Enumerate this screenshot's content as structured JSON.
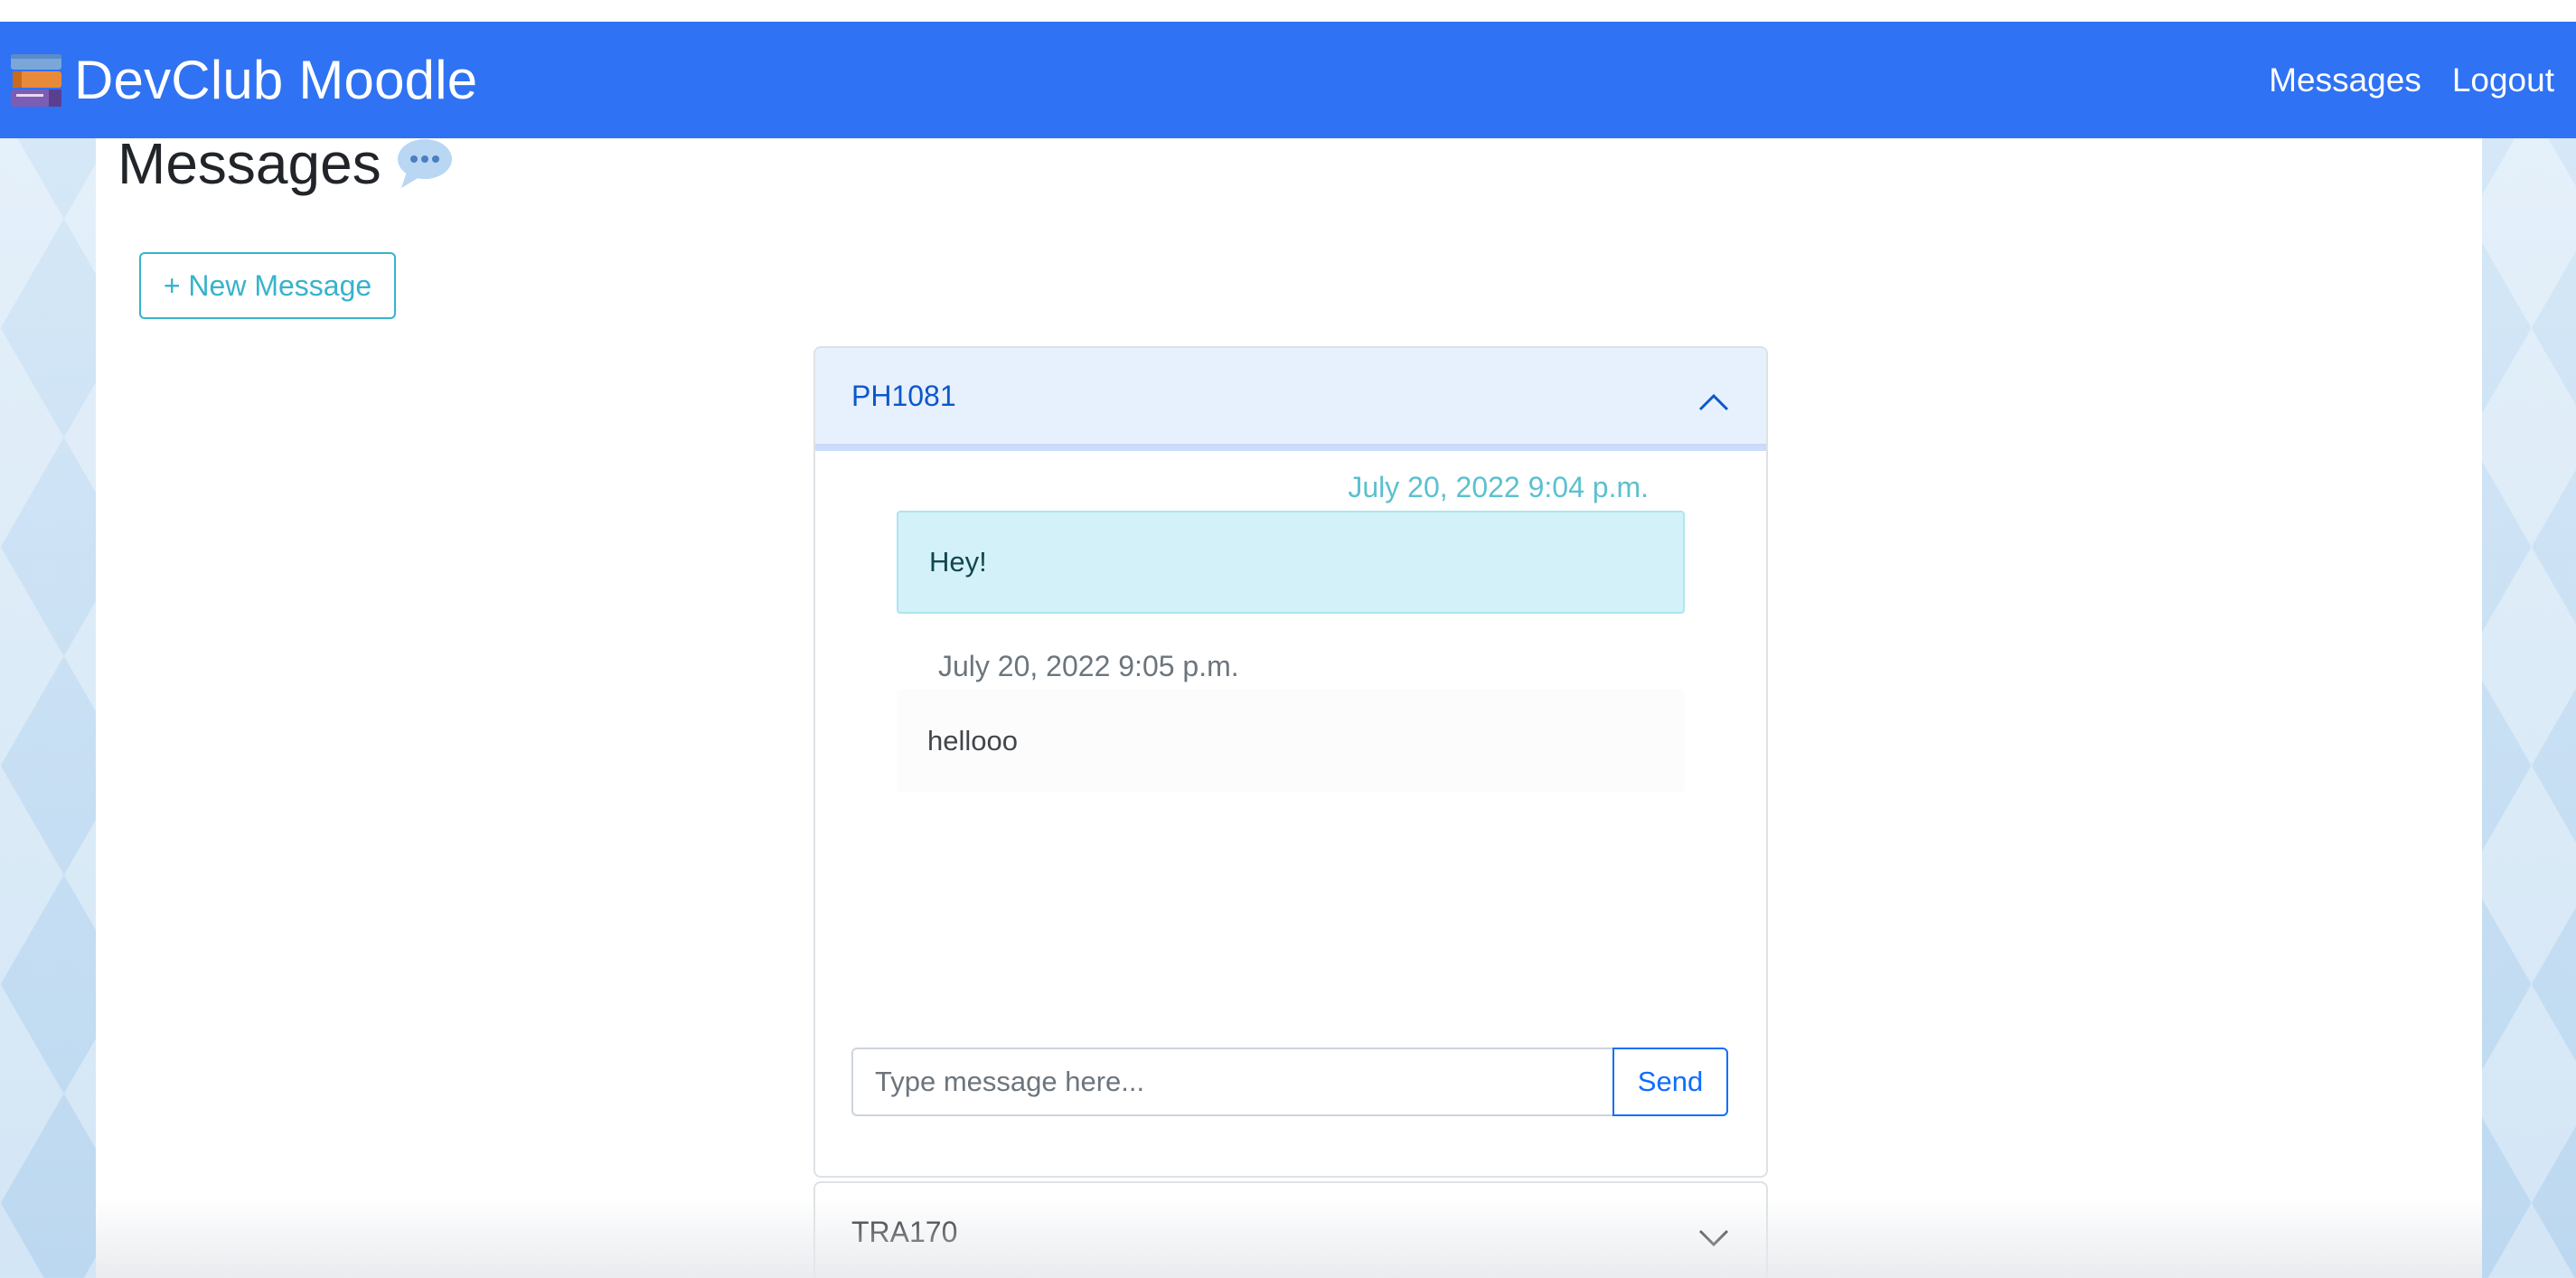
{
  "navbar": {
    "brand": "DevClub Moodle",
    "brand_icon": "books-icon",
    "links": [
      "Messages",
      "Logout"
    ],
    "color": "#2f72f3"
  },
  "page": {
    "title": "Messages",
    "title_icon": "speech-bubble-icon",
    "new_message_label": "+ New Message"
  },
  "conversations": [
    {
      "name": "PH1081",
      "expanded": true,
      "messages": [
        {
          "timestamp": "July 20, 2022 9:04 p.m.",
          "text": "Hey!",
          "direction": "sent"
        },
        {
          "timestamp": "July 20, 2022 9:05 p.m.",
          "text": "hellooo",
          "direction": "received"
        }
      ],
      "input_placeholder": "Type message here...",
      "send_label": "Send"
    },
    {
      "name": "TRA170",
      "expanded": false
    }
  ],
  "colors": {
    "accent": "#0d6efd",
    "info": "#37b3cc",
    "sent_bubble": "#d3f1f8"
  }
}
